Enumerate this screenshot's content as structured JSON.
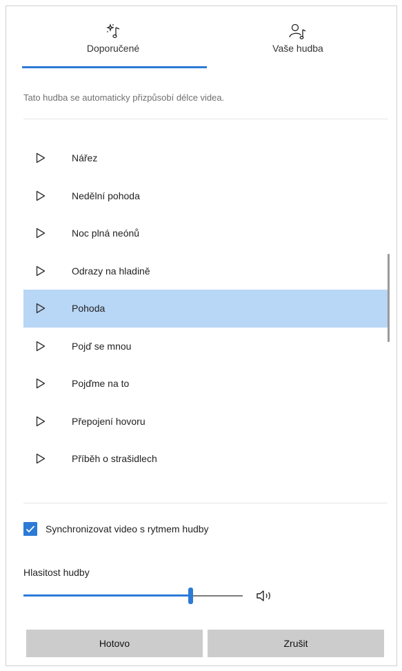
{
  "tabs": {
    "recommended": {
      "label": "Doporučené",
      "icon": "sparkle-music-icon",
      "active": true
    },
    "your_music": {
      "label": "Vaše hudba",
      "icon": "person-music-icon",
      "active": false
    }
  },
  "hint": "Tato hudba se automaticky přizpůsobí délce videa.",
  "tracks": [
    {
      "name": "Nářez",
      "selected": false
    },
    {
      "name": "Nedělní pohoda",
      "selected": false
    },
    {
      "name": "Noc plná neónů",
      "selected": false
    },
    {
      "name": "Odrazy na hladině",
      "selected": false
    },
    {
      "name": "Pohoda",
      "selected": true
    },
    {
      "name": "Pojď se mnou",
      "selected": false
    },
    {
      "name": "Pojďme na to",
      "selected": false
    },
    {
      "name": "Přepojení hovoru",
      "selected": false
    },
    {
      "name": "Příběh o strašidlech",
      "selected": false
    }
  ],
  "sync": {
    "label": "Synchronizovat video s rytmem hudby",
    "checked": true
  },
  "volume": {
    "label": "Hlasitost hudby",
    "level": 0.76,
    "icon": "speaker-icon"
  },
  "buttons": {
    "done": "Hotovo",
    "cancel": "Zrušit"
  },
  "colors": {
    "accent": "#2c7ad6",
    "selected_row": "#b8d6f5",
    "button_bg": "#cccccc"
  }
}
